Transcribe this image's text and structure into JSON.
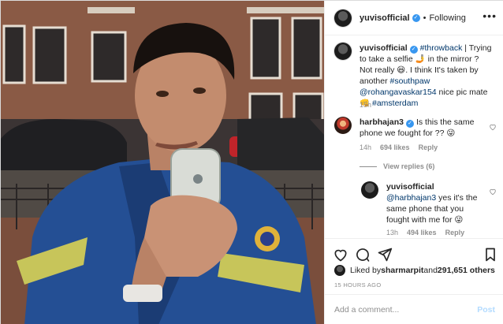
{
  "header": {
    "username": "yuvisofficial",
    "separator": "•",
    "follow_status": "Following",
    "more_icon": "more-horizontal-icon"
  },
  "caption": {
    "username": "yuvisofficial",
    "text_1": " ",
    "hashtag_1": "#throwback",
    "text_2": " | Trying to take a selfie 🤳 in the mirror ? Not really 😆. I think It's taken by another ",
    "hashtag_2": "#southpaw",
    "text_3": " ",
    "mention_1": "@rohangavaskar154",
    "text_4": " nice pic mate 👊 ",
    "hashtag_3": "#amsterdam",
    "time": "15h"
  },
  "comments": [
    {
      "username": "harbhajan3",
      "text": " Is this the same phone we fought for ?? 😜",
      "time": "14h",
      "likes": "694 likes",
      "reply_label": "Reply"
    }
  ],
  "view_replies": "View replies (6)",
  "reply": {
    "username": "yuvisofficial",
    "mention": "@harbhajan3",
    "text": " yes it's the same phone that you fought with me for 😜",
    "time": "13h",
    "likes": "494 likes",
    "reply_label": "Reply"
  },
  "liked_by": {
    "prefix": "Liked by ",
    "user": "sharmarpit",
    "middle": " and ",
    "count": "291,651 others"
  },
  "timestamp": "15 HOURS AGO",
  "add_comment": {
    "placeholder": "Add a comment...",
    "post_label": "Post"
  },
  "colors": {
    "link": "#00376b",
    "verified": "#3897f0",
    "post_button": "#b3dbff",
    "muted": "#8e8e8e"
  }
}
